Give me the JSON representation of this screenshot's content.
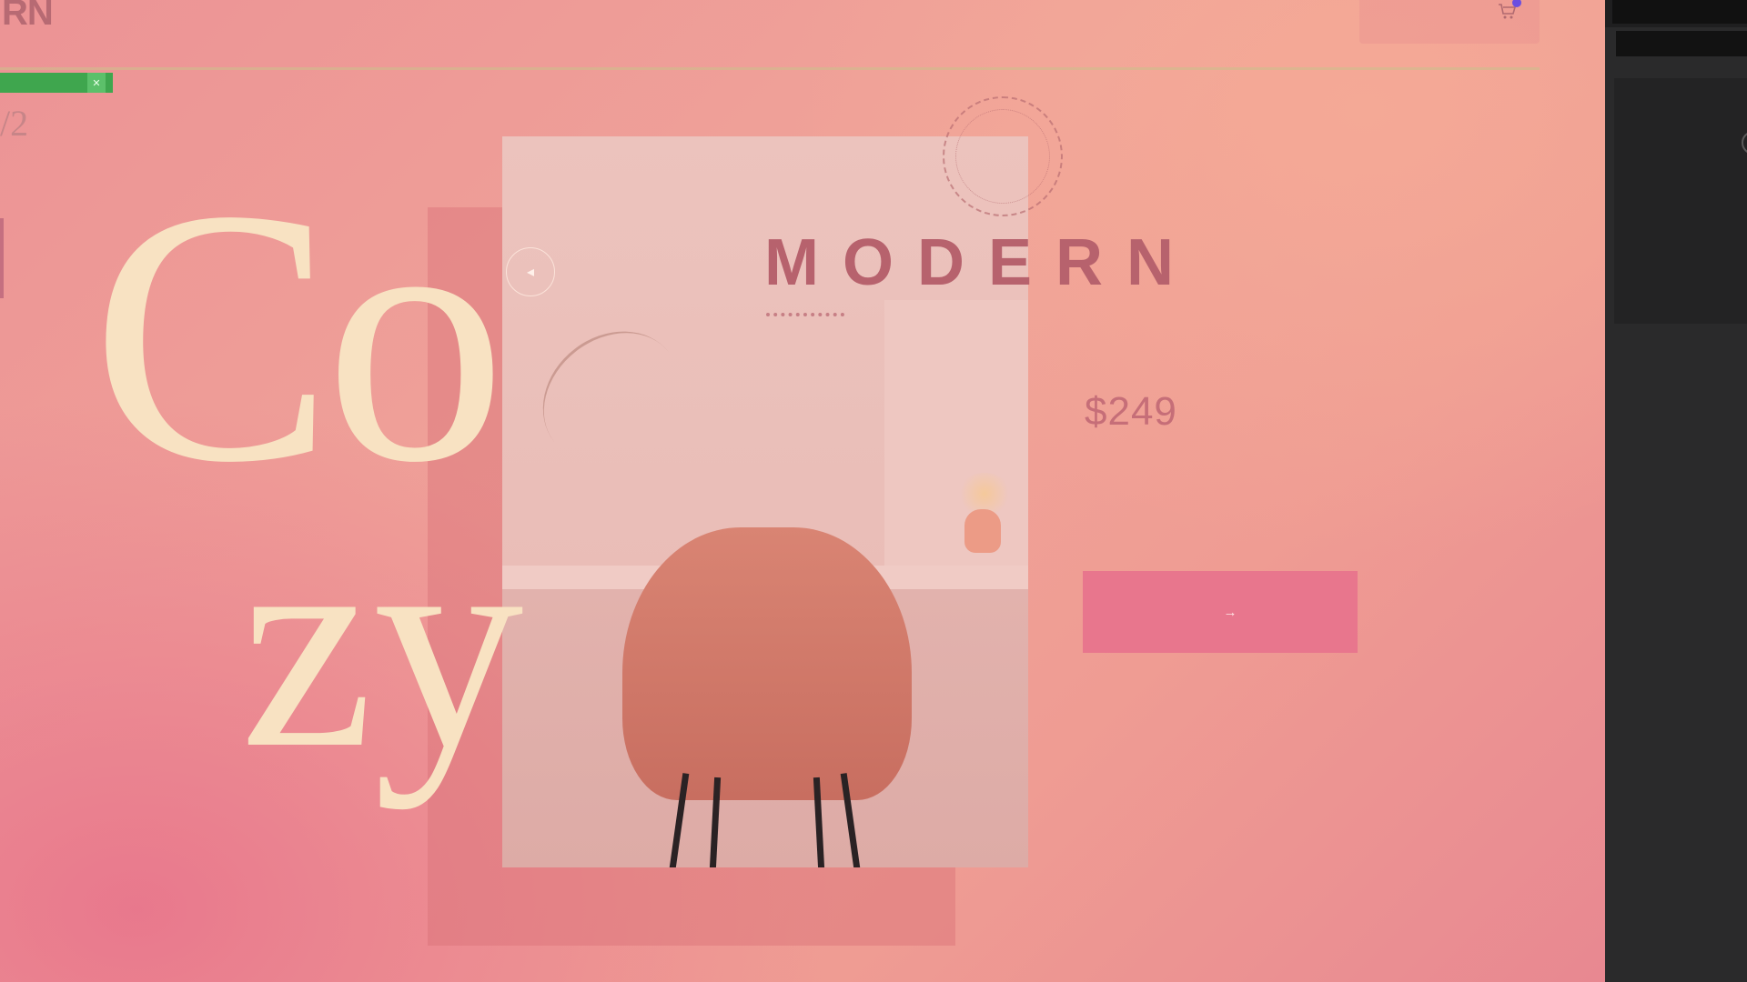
{
  "brand": {
    "logo": "RN",
    "logo_sub": ""
  },
  "nav": {
    "items": [
      "",
      "",
      "",
      ""
    ]
  },
  "header": {
    "search_label": "",
    "cart_icon": "cart-icon"
  },
  "badge": {
    "label": "",
    "close": "✕"
  },
  "slide": {
    "counter": "/2",
    "caption": ""
  },
  "hero": {
    "word_big": "Co",
    "word_small": "zy",
    "subtitle_word": "MODERN"
  },
  "product": {
    "kicker": "",
    "price": "$249",
    "description": "",
    "cta_label": "",
    "cta_icon": "arrow-right-icon",
    "vertical_label": ""
  },
  "photo": {
    "badge_icon": "circle-arrow-icon"
  },
  "dev_panel": {
    "tab_label": "",
    "input_value": "",
    "lines": []
  },
  "colors": {
    "accent_pink": "#e8768d",
    "cream": "#f8e2c2",
    "brand_text": "#b7626d",
    "badge_green": "#3fa64e"
  }
}
